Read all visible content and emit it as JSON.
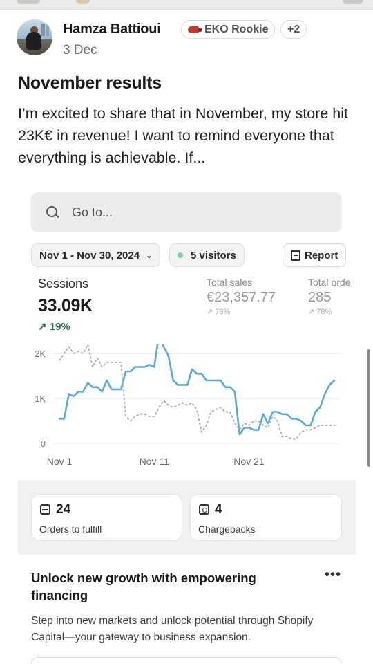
{
  "post": {
    "author": "Hamza Battioui",
    "date": "3 Dec",
    "badges": {
      "rookie": "EKO Rookie",
      "more": "+2"
    },
    "title": "November results",
    "body": "I’m excited to share that in November, my store hit 23K€ in revenue! I want to remind everyone that everything is achievable. If..."
  },
  "screenshot": {
    "search": {
      "placeholder": "Go to..."
    },
    "filters": {
      "date_range": "Nov 1 - Nov 30, 2024",
      "visitors": "5 visitors",
      "report": "Report"
    },
    "metrics": {
      "sessions": {
        "label": "Sessions",
        "value": "33.09K",
        "change": "19%"
      },
      "total_sales": {
        "label": "Total sales",
        "value": "€23,357.77",
        "change": "78%"
      },
      "total_orders": {
        "label": "Total orde",
        "value": "285",
        "change": "78%"
      }
    },
    "cards": {
      "fulfill": {
        "value": "24",
        "label": "Orders to fulfill"
      },
      "chargebacks": {
        "value": "4",
        "label": "Chargebacks"
      }
    },
    "promo": {
      "title": "Unlock new growth with empowering financing",
      "body": "Step into new markets and unlock potential through Shopify Capital—your gateway to business expansion.",
      "more": "•••"
    }
  },
  "chart_data": {
    "type": "line",
    "x_ticks": [
      "Nov 1",
      "Nov 11",
      "Nov 21"
    ],
    "y_ticks": [
      "2K",
      "1K",
      "0"
    ],
    "ylim": [
      0,
      2200
    ],
    "xlim": [
      1,
      30
    ],
    "grid": true,
    "colors": {
      "current": "#5aa9d6",
      "comparison": "#b5b5b5",
      "grid": "#e6e6e6"
    },
    "series": [
      {
        "style": "solid",
        "x": [
          1,
          1.5,
          2,
          2.5,
          3,
          3.5,
          4,
          4.5,
          5,
          5.5,
          6,
          6.5,
          7,
          7.5,
          8,
          8.5,
          9,
          9.5,
          10,
          10.5,
          11,
          11.5,
          12,
          12.5,
          13,
          13.5,
          14,
          14.5,
          15,
          15.5,
          16,
          16.5,
          17,
          17.5,
          18,
          18.5,
          19,
          19.5,
          20,
          20.5,
          21,
          21.5,
          22,
          22.5,
          23,
          23.5,
          24,
          24.5,
          25,
          25.5,
          26,
          26.5,
          27,
          27.5,
          28,
          28.5,
          29,
          29.5,
          30
        ],
        "values": [
          550,
          550,
          1100,
          1050,
          1150,
          1150,
          1350,
          1250,
          1250,
          1150,
          1400,
          1200,
          1200,
          1200,
          1600,
          1600,
          1700,
          1700,
          1700,
          1750,
          1700,
          2400,
          2150,
          1950,
          1400,
          1300,
          1300,
          1300,
          1650,
          1550,
          1550,
          1400,
          1400,
          1400,
          1400,
          1250,
          1250,
          1150,
          200,
          350,
          350,
          300,
          300,
          650,
          450,
          700,
          700,
          650,
          650,
          550,
          550,
          500,
          400,
          400,
          700,
          800,
          1100,
          1300,
          1400
        ]
      },
      {
        "style": "dotted",
        "x": [
          1,
          1.5,
          2,
          2.5,
          3,
          3.5,
          4,
          4.5,
          5,
          5.5,
          6,
          6.5,
          7,
          7.5,
          8,
          8.5,
          9,
          9.5,
          10,
          10.5,
          11,
          11.5,
          12,
          12.5,
          13,
          13.5,
          14,
          14.5,
          15,
          15.5,
          16,
          16.5,
          17,
          17.5,
          18,
          18.5,
          19,
          19.5,
          20,
          20.5,
          21,
          21.5,
          22,
          22.5,
          23,
          23.5,
          24,
          24.5,
          25,
          25.5,
          26,
          26.5,
          27,
          27.5,
          28,
          28.5,
          29,
          29.5,
          30
        ],
        "values": [
          1850,
          2000,
          2150,
          2000,
          2050,
          2000,
          2200,
          1700,
          1900,
          1700,
          1800,
          1800,
          1800,
          1800,
          600,
          500,
          600,
          650,
          650,
          600,
          600,
          800,
          950,
          850,
          800,
          850,
          900,
          850,
          900,
          750,
          250,
          400,
          700,
          750,
          800,
          700,
          700,
          450,
          300,
          450,
          400,
          500,
          500,
          400,
          350,
          600,
          500,
          150,
          150,
          100,
          100,
          250,
          300,
          300,
          350,
          400,
          400,
          400,
          400
        ]
      }
    ]
  }
}
